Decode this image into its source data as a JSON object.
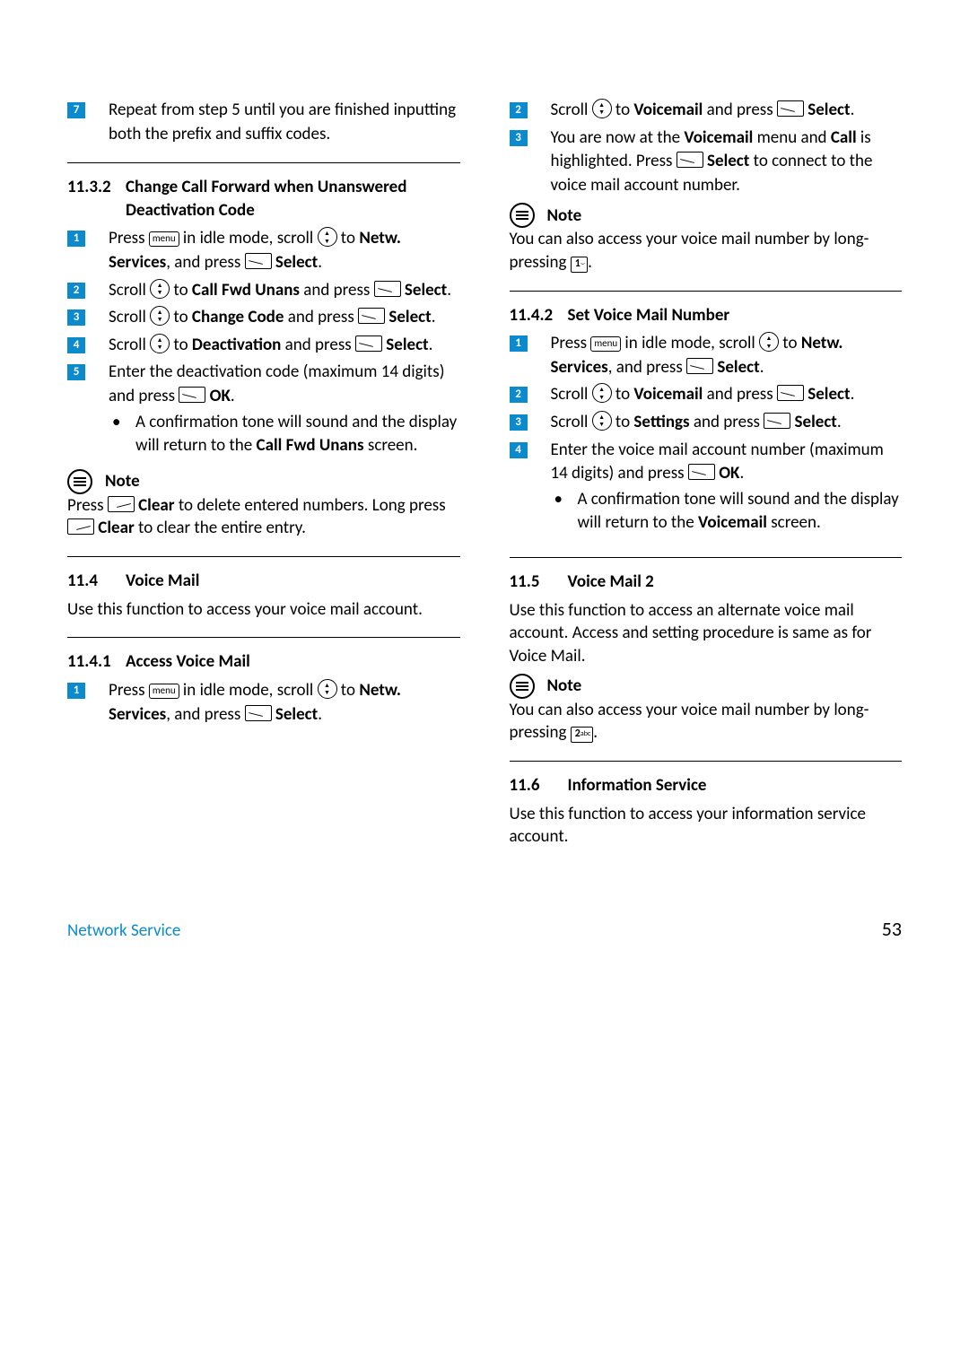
{
  "footer": {
    "section": "Network Service",
    "page": "53"
  },
  "note_label": "Note",
  "left": {
    "step7": "Repeat from step 5 until you are finished inputting both the prefix and suffix codes.",
    "h_11_3_2_num": "11.3.2",
    "h_11_3_2_txt": "Change Call Forward when Unanswered Deactivation Code",
    "s1_a": "Press ",
    "s1_b": " in idle mode, scroll ",
    "s1_c": " to ",
    "s1_netw": "Netw. Services",
    "s1_d": ", and press ",
    "s1_select": "Select",
    "s1_e": ".",
    "s2_a": "Scroll ",
    "s2_b": " to ",
    "s2_target": "Call Fwd Unans",
    "s2_c": " and press ",
    "s2_select": " Select",
    "s2_d": ".",
    "s3_a": "Scroll ",
    "s3_b": " to ",
    "s3_target": "Change Code",
    "s3_c": " and press ",
    "s3_select": " Select",
    "s3_d": ".",
    "s4_a": "Scroll ",
    "s4_b": " to ",
    "s4_target": "Deactivation",
    "s4_c": " and press ",
    "s4_select": " Select",
    "s4_d": ".",
    "s5_a": "Enter the deactivation code (maximum 14 digits) and press ",
    "s5_ok": "OK",
    "s5_b": ".",
    "s5_bul_a": "A confirmation tone will sound and the display will return to the ",
    "s5_bul_b": "Call Fwd Unans",
    "s5_bul_c": " screen.",
    "note1_a": "Press ",
    "note1_clear1": "Clear",
    "note1_b": " to delete entered numbers. Long press ",
    "note1_clear2": "Clear",
    "note1_c": " to clear the entire entry.",
    "h_11_4_num": "11.4",
    "h_11_4_txt": "Voice Mail",
    "p_11_4": "Use this function to access your voice mail account.",
    "h_11_4_1_num": "11.4.1",
    "h_11_4_1_txt": "Access Voice Mail",
    "avm1_a": "Press ",
    "avm1_b": " in idle mode, scroll ",
    "avm1_c": " to ",
    "avm1_netw": "Netw. Services",
    "avm1_d": ", and press ",
    "avm1_select": "Select",
    "avm1_e": "."
  },
  "right": {
    "s2_a": "Scroll ",
    "s2_b": " to ",
    "s2_target": "Voicemail",
    "s2_c": " and press ",
    "s2_select": "Select",
    "s2_d": ".",
    "s3_a": "You are now at the ",
    "s3_vm": "Voicemail",
    "s3_b": " menu and ",
    "s3_call": "Call",
    "s3_c": " is highlighted. Press ",
    "s3_select": "Select",
    "s3_d": " to connect to the voice mail account number.",
    "note2_a": "You can also access your voice mail number by long-pressing ",
    "note2_b": ".",
    "h_11_4_2_num": "11.4.2",
    "h_11_4_2_txt": "Set Voice Mail Number",
    "svm1_a": "Press ",
    "svm1_b": " in idle mode, scroll ",
    "svm1_c": " to ",
    "svm1_netw": "Netw. Services",
    "svm1_d": ", and press ",
    "svm1_select": "Select",
    "svm1_e": ".",
    "svm2_a": "Scroll ",
    "svm2_b": " to ",
    "svm2_target": "Voicemail",
    "svm2_c": " and press ",
    "svm2_select": "Select",
    "svm2_d": ".",
    "svm3_a": "Scroll ",
    "svm3_b": " to ",
    "svm3_target": "Settings",
    "svm3_c": " and press ",
    "svm3_select": "Select",
    "svm3_d": ".",
    "svm4_a": "Enter the voice mail account number (maximum 14 digits) and press ",
    "svm4_ok": "OK",
    "svm4_b": ".",
    "svm4_bul_a": "A confirmation tone will sound and the display will return to the ",
    "svm4_bul_b": "Voicemail",
    "svm4_bul_c": " screen.",
    "h_11_5_num": "11.5",
    "h_11_5_txt": "Voice Mail 2",
    "p_11_5": "Use this function to access an alternate voice mail account. Access and setting procedure is same as for Voice Mail.",
    "note3_a": "You can also access your voice mail number by long-pressing ",
    "note3_b": ".",
    "h_11_6_num": "11.6",
    "h_11_6_txt": "Information Service",
    "p_11_6": "Use this function to access your information service account."
  },
  "key_menu": "menu",
  "key_1": "1",
  "key_1_sub": "⌣",
  "key_2": "2",
  "key_2_sub": "abc"
}
